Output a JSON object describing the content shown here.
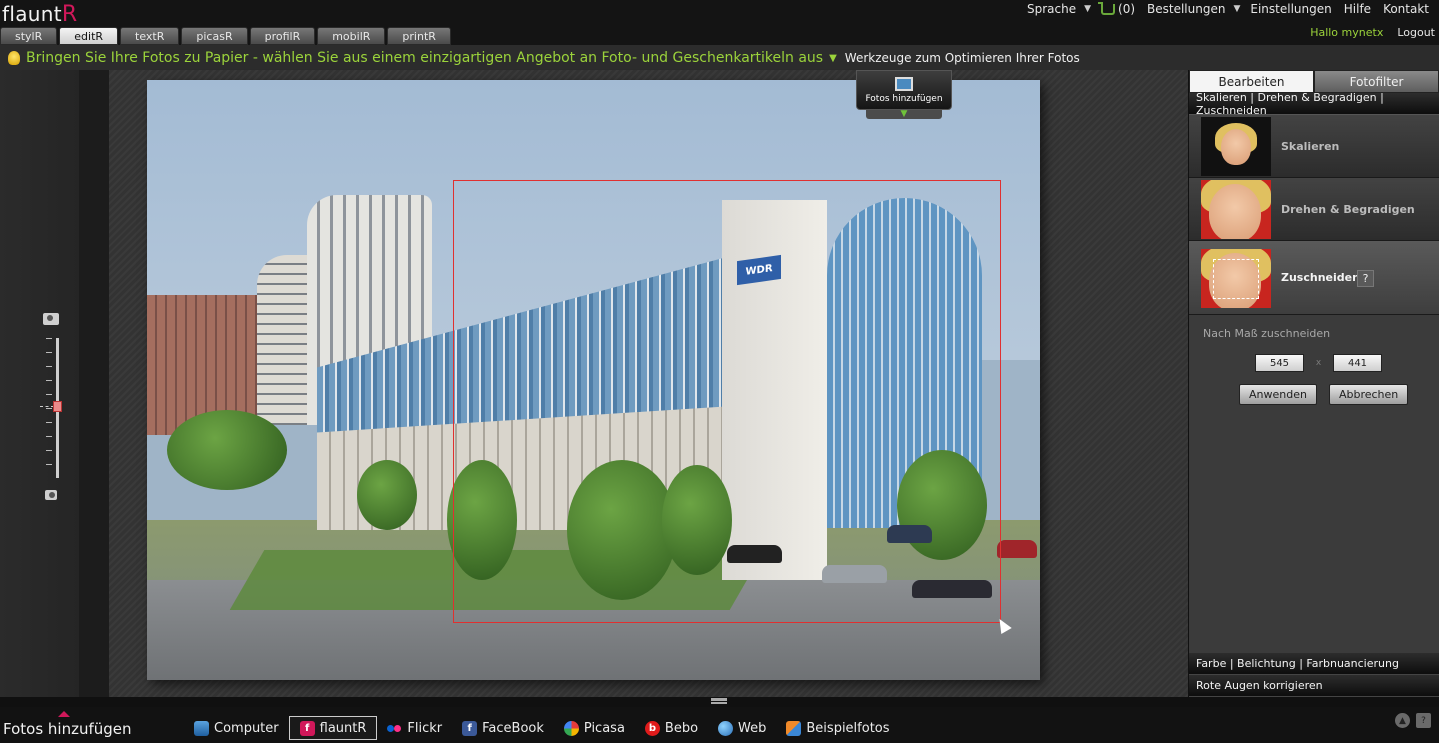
{
  "app": {
    "logo_main": "flaunt",
    "logo_accent": "R"
  },
  "header": {
    "links": {
      "sprache": "Sprache",
      "cart_count": "(0)",
      "bestellungen": "Bestellungen",
      "einstellungen": "Einstellungen",
      "hilfe": "Hilfe",
      "kontakt": "Kontakt"
    },
    "greeting": "Hallo mynetx",
    "logout": "Logout",
    "tabs": [
      {
        "label": "stylR"
      },
      {
        "label": "editR",
        "active": true
      },
      {
        "label": "textR"
      },
      {
        "label": "picasR"
      },
      {
        "label": "profilR"
      },
      {
        "label": "mobilR"
      },
      {
        "label": "printR"
      }
    ]
  },
  "promo": {
    "text": "Bringen Sie Ihre Fotos zu Papier - wählen Sie aus einem einzigartigen Angebot an Foto- und Geschenkartikeln aus",
    "tools_text": "Werkzeuge zum Optimieren Ihrer Fotos"
  },
  "canvas": {
    "add_photos_popup": "Fotos hinzufügen",
    "sign_text": "WDR"
  },
  "right_panel": {
    "tabs": [
      {
        "label": "Bearbeiten",
        "active": true
      },
      {
        "label": "Fotofilter"
      }
    ],
    "section_title": "Skalieren | Drehen & Begradigen | Zuschneiden",
    "tools": [
      {
        "label": "Skalieren"
      },
      {
        "label": "Drehen & Begradigen"
      },
      {
        "label": "Zuschneiden",
        "active": true
      }
    ],
    "help_label": "?",
    "crop": {
      "caption": "Nach Maß zuschneiden",
      "width": "545",
      "times": "x",
      "height": "441",
      "apply": "Anwenden",
      "cancel": "Abbrechen"
    },
    "bottom_sections": [
      {
        "label": "Farbe  | Belichtung | Farbnuancierung"
      },
      {
        "label": "Rote Augen korrigieren"
      }
    ]
  },
  "bottom": {
    "add_label": "Fotos hinzufügen",
    "sources": [
      {
        "label": "Computer",
        "icon": "computer-icon"
      },
      {
        "label": "flauntR",
        "icon": "flauntr-icon",
        "active": true
      },
      {
        "label": "Flickr",
        "icon": "flickr-icon"
      },
      {
        "label": "FaceBook",
        "icon": "facebook-icon"
      },
      {
        "label": "Picasa",
        "icon": "picasa-icon"
      },
      {
        "label": "Bebo",
        "icon": "bebo-icon"
      },
      {
        "label": "Web",
        "icon": "globe-icon"
      },
      {
        "label": "Beispielfotos",
        "icon": "sample-photos-icon"
      }
    ],
    "source_icon_glyphs": {
      "flauntr": "f",
      "facebook": "f",
      "bebo": "b"
    },
    "corner_icons": {
      "up": "▲",
      "help": "?"
    }
  },
  "colors": {
    "accent_green": "#9bd33b",
    "brand_pink": "#d0185a",
    "crop_border": "#e03030"
  }
}
